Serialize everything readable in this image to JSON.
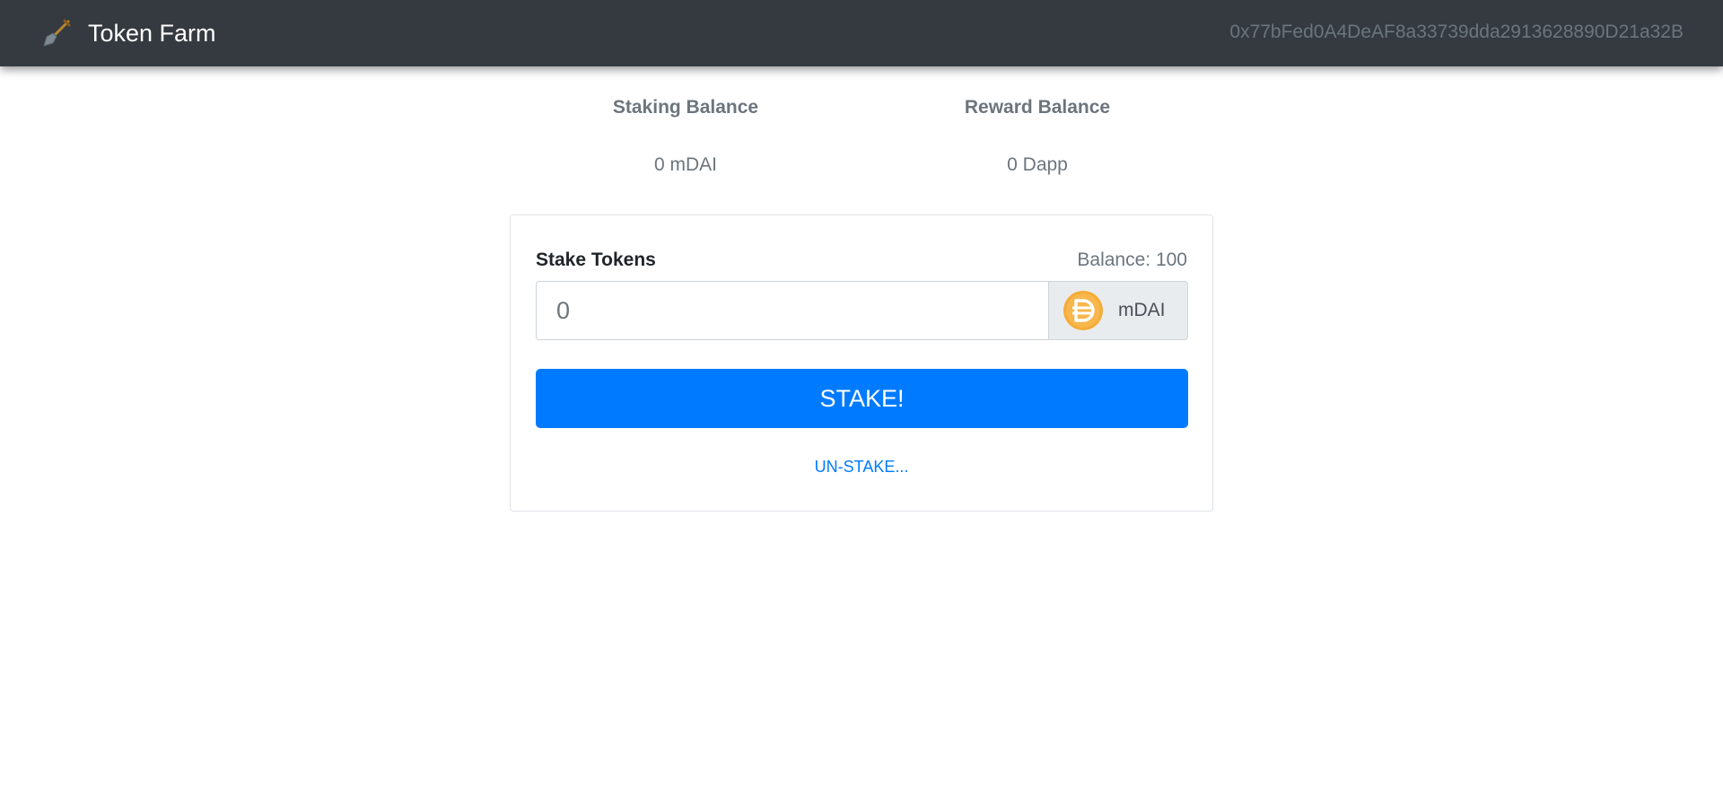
{
  "navbar": {
    "brand": "Token Farm",
    "brand_icon": "shovel-icon",
    "account": "0x77bFed0A4DeAF8a33739dda2913628890D21a32B"
  },
  "balances": {
    "staking": {
      "label": "Staking Balance",
      "value": "0 mDAI"
    },
    "reward": {
      "label": "Reward Balance",
      "value": "0 Dapp"
    }
  },
  "stake_form": {
    "title": "Stake Tokens",
    "wallet_balance": "Balance: 100",
    "input_placeholder": "0",
    "token_symbol": "mDAI",
    "token_icon": "dai-coin-icon",
    "stake_button": "STAKE!",
    "unstake_link": "UN-STAKE..."
  },
  "colors": {
    "navbar": "#343a40",
    "primary": "#007bff",
    "muted": "#6c757d",
    "coin": "#f5ac37"
  }
}
